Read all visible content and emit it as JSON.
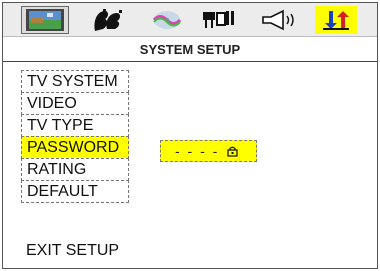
{
  "colors": {
    "highlight": "#ffff00",
    "bar_background": "#ececec",
    "selected_icon": "#dcdcdc"
  },
  "icon_bar": {
    "icons": [
      {
        "name": "tv-screen-icon",
        "state": "selected"
      },
      {
        "name": "faces-language-icon",
        "state": "normal"
      },
      {
        "name": "disc-audio-icon",
        "state": "normal"
      },
      {
        "name": "video-settings-icon",
        "state": "normal"
      },
      {
        "name": "speaker-icon",
        "state": "normal"
      },
      {
        "name": "system-setup-arrows-icon",
        "state": "active"
      }
    ]
  },
  "title": "SYSTEM SETUP",
  "menu": {
    "items": [
      {
        "label": "TV SYSTEM"
      },
      {
        "label": "VIDEO"
      },
      {
        "label": "TV TYPE"
      },
      {
        "label": "PASSWORD",
        "highlighted": true
      },
      {
        "label": "RATING"
      },
      {
        "label": "DEFAULT"
      }
    ]
  },
  "password": {
    "value": "- - - -",
    "icon": "lock-icon"
  },
  "exit_label": "EXIT SETUP"
}
